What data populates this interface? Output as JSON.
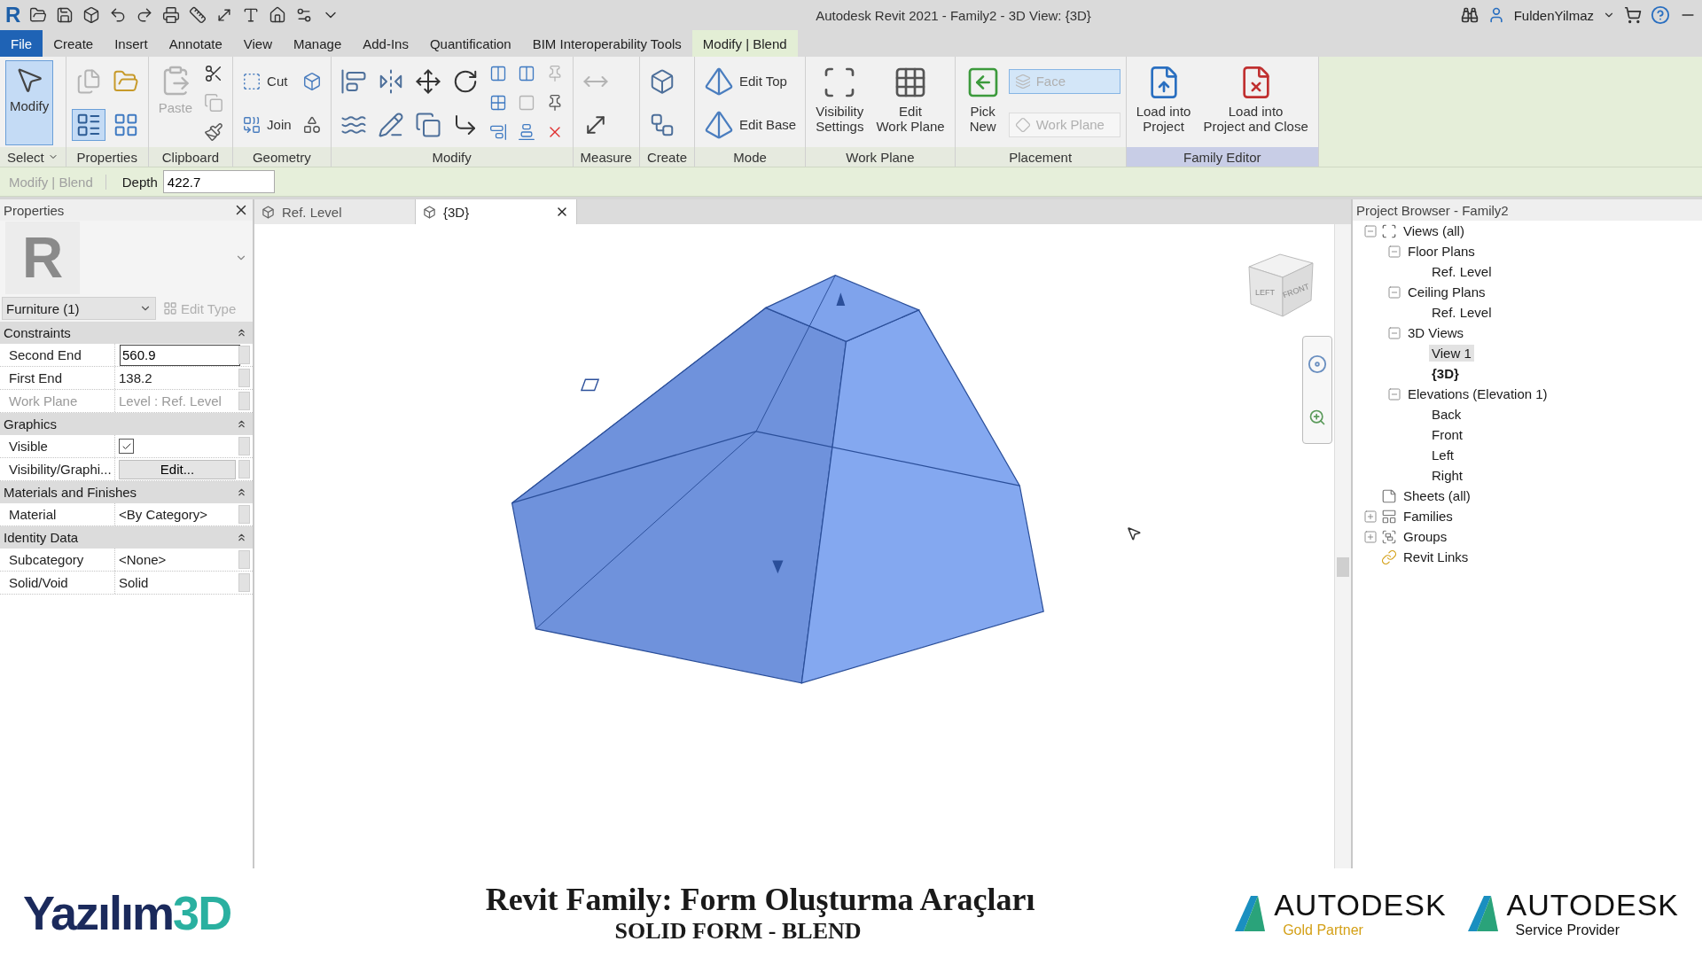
{
  "title_bar": {
    "app_logo": "R",
    "title": "Autodesk Revit 2021 - Family2 - 3D View: {3D}",
    "user": "FuldenYilmaz"
  },
  "menu_tabs": [
    {
      "label": "File",
      "kind": "file",
      "selected": false
    },
    {
      "label": "Create",
      "kind": "tab",
      "selected": false
    },
    {
      "label": "Insert",
      "kind": "tab",
      "selected": false
    },
    {
      "label": "Annotate",
      "kind": "tab",
      "selected": false
    },
    {
      "label": "View",
      "kind": "tab",
      "selected": false
    },
    {
      "label": "Manage",
      "kind": "tab",
      "selected": false
    },
    {
      "label": "Add-Ins",
      "kind": "tab",
      "selected": false
    },
    {
      "label": "Quantification",
      "kind": "tab",
      "selected": false
    },
    {
      "label": "BIM Interoperability Tools",
      "kind": "tab",
      "selected": false
    },
    {
      "label": "Modify | Blend",
      "kind": "context",
      "selected": true
    }
  ],
  "ribbon": {
    "panels": [
      {
        "label": "Select",
        "dropdown": true,
        "highlighted": false,
        "tools": [
          {
            "kind": "large",
            "label": "Modify",
            "selected": true,
            "disabled": false
          }
        ]
      },
      {
        "label": "Properties",
        "dropdown": false,
        "highlighted": false,
        "tools": [
          {
            "kind": "medium",
            "selected": false,
            "disabled": true
          },
          {
            "kind": "medium",
            "selected": true,
            "disabled": false
          },
          {
            "kind": "medium",
            "selected": false,
            "disabled": false
          },
          {
            "kind": "medium",
            "selected": false,
            "disabled": false
          }
        ]
      },
      {
        "label": "Clipboard",
        "dropdown": false,
        "highlighted": false,
        "tools": [
          {
            "kind": "large",
            "label": "Paste",
            "selected": false,
            "disabled": true
          },
          {
            "kind": "small",
            "selected": false,
            "disabled": false
          },
          {
            "kind": "small",
            "selected": false,
            "disabled": true
          },
          {
            "kind": "small",
            "selected": false,
            "disabled": false
          }
        ]
      },
      {
        "label": "Geometry",
        "dropdown": false,
        "highlighted": false,
        "tools": [
          {
            "kind": "medium",
            "label": "Cut",
            "selected": false,
            "disabled": false
          },
          {
            "kind": "medium",
            "label": "Join",
            "selected": false,
            "disabled": false
          },
          {
            "kind": "medium",
            "selected": false,
            "disabled": false
          },
          {
            "kind": "medium",
            "selected": false,
            "disabled": false
          }
        ]
      },
      {
        "label": "Modify",
        "dropdown": false,
        "highlighted": false,
        "tools": [
          {
            "kind": "medium",
            "selected": false,
            "disabled": false
          },
          {
            "kind": "medium",
            "selected": false,
            "disabled": false
          },
          {
            "kind": "medium",
            "selected": false,
            "disabled": false
          },
          {
            "kind": "medium",
            "selected": false,
            "disabled": false
          },
          {
            "kind": "medium",
            "selected": false,
            "disabled": false
          },
          {
            "kind": "medium",
            "selected": false,
            "disabled": false
          },
          {
            "kind": "medium",
            "selected": false,
            "disabled": false
          },
          {
            "kind": "medium",
            "selected": false,
            "disabled": false
          },
          {
            "kind": "small",
            "selected": false,
            "disabled": false
          },
          {
            "kind": "small",
            "selected": false,
            "disabled": false
          },
          {
            "kind": "small",
            "selected": false,
            "disabled": false
          },
          {
            "kind": "small",
            "selected": false,
            "disabled": false
          },
          {
            "kind": "small",
            "selected": false,
            "disabled": true
          },
          {
            "kind": "small",
            "selected": false,
            "disabled": false
          },
          {
            "kind": "small",
            "selected": false,
            "disabled": true
          },
          {
            "kind": "small",
            "selected": false,
            "disabled": false
          },
          {
            "kind": "small",
            "selected": false,
            "disabled": false
          }
        ]
      },
      {
        "label": "Measure",
        "dropdown": false,
        "highlighted": false,
        "tools": [
          {
            "kind": "medium",
            "selected": false,
            "disabled": true
          },
          {
            "kind": "medium",
            "selected": false,
            "disabled": false
          }
        ]
      },
      {
        "label": "Create",
        "dropdown": false,
        "highlighted": false,
        "tools": [
          {
            "kind": "medium",
            "selected": false,
            "disabled": false
          },
          {
            "kind": "medium",
            "selected": false,
            "disabled": false
          }
        ]
      },
      {
        "label": "Mode",
        "dropdown": false,
        "highlighted": false,
        "tools": [
          {
            "kind": "medium",
            "label": "Edit Top",
            "selected": false,
            "disabled": false
          },
          {
            "kind": "medium",
            "label": "Edit Base",
            "selected": false,
            "disabled": false
          }
        ]
      },
      {
        "label": "Work Plane",
        "dropdown": false,
        "highlighted": false,
        "tools": [
          {
            "kind": "large",
            "label": "Visibility\nSettings",
            "selected": false,
            "disabled": false
          },
          {
            "kind": "large",
            "label": "Edit\nWork Plane",
            "selected": false,
            "disabled": false
          }
        ]
      },
      {
        "label": "Placement",
        "dropdown": false,
        "highlighted": false,
        "tools": [
          {
            "kind": "large",
            "label": "Pick\nNew",
            "selected": false,
            "disabled": false
          },
          {
            "kind": "option",
            "label": "Face",
            "selected": true,
            "disabled": true
          },
          {
            "kind": "option",
            "label": "Work Plane",
            "selected": false,
            "disabled": true
          }
        ]
      },
      {
        "label": "Family Editor",
        "dropdown": false,
        "highlighted": true,
        "tools": [
          {
            "kind": "large",
            "label": "Load into\nProject",
            "selected": false,
            "disabled": false
          },
          {
            "kind": "large",
            "label": "Load into\nProject and Close",
            "selected": false,
            "disabled": false
          }
        ]
      }
    ]
  },
  "options_bar": {
    "context": "Modify | Blend",
    "depth_label": "Depth",
    "depth_value": "422.7"
  },
  "properties": {
    "title": "Properties",
    "preview_glyph": "R",
    "type_selector": "Furniture (1)",
    "edit_type": "Edit Type",
    "groups": [
      {
        "name": "Constraints",
        "rows": [
          {
            "name": "Second End",
            "kind": "input",
            "value": "560.9",
            "disabled": false
          },
          {
            "name": "First End",
            "kind": "text",
            "value": "138.2",
            "disabled": false
          },
          {
            "name": "Work Plane",
            "kind": "text",
            "value": "Level : Ref. Level",
            "disabled": true
          }
        ]
      },
      {
        "name": "Graphics",
        "rows": [
          {
            "name": "Visible",
            "kind": "checkbox",
            "checked": true,
            "disabled": false
          },
          {
            "name": "Visibility/Graphi...",
            "kind": "button",
            "value": "Edit...",
            "disabled": false
          }
        ]
      },
      {
        "name": "Materials and Finishes",
        "rows": [
          {
            "name": "Material",
            "kind": "text",
            "value": "<By Category>",
            "disabled": false
          }
        ]
      },
      {
        "name": "Identity Data",
        "rows": [
          {
            "name": "Subcategory",
            "kind": "text",
            "value": "<None>",
            "disabled": false
          },
          {
            "name": "Solid/Void",
            "kind": "text",
            "value": "Solid",
            "disabled": false
          }
        ]
      }
    ]
  },
  "view_tabs": [
    {
      "label": "Ref. Level",
      "selected": false
    },
    {
      "label": "{3D}",
      "selected": true
    }
  ],
  "viewport": {
    "view_cube": {
      "left": "LEFT",
      "front": "FRONT"
    }
  },
  "project_browser": {
    "title": "Project Browser - Family2",
    "tree": [
      {
        "label": "Views (all)",
        "expanded": true,
        "selected": false,
        "current": false,
        "children": [
          {
            "label": "Floor Plans",
            "expanded": true,
            "selected": false,
            "current": false,
            "children": [
              {
                "label": "Ref. Level",
                "selected": false,
                "current": false
              }
            ]
          },
          {
            "label": "Ceiling Plans",
            "expanded": true,
            "selected": false,
            "current": false,
            "children": [
              {
                "label": "Ref. Level",
                "selected": false,
                "current": false
              }
            ]
          },
          {
            "label": "3D Views",
            "expanded": true,
            "selected": false,
            "current": false,
            "children": [
              {
                "label": "View 1",
                "selected": true,
                "current": false
              },
              {
                "label": "{3D}",
                "selected": false,
                "current": true
              }
            ]
          },
          {
            "label": "Elevations (Elevation 1)",
            "expanded": true,
            "selected": false,
            "current": false,
            "children": [
              {
                "label": "Back",
                "selected": false,
                "current": false
              },
              {
                "label": "Front",
                "selected": false,
                "current": false
              },
              {
                "label": "Left",
                "selected": false,
                "current": false
              },
              {
                "label": "Right",
                "selected": false,
                "current": false
              }
            ]
          }
        ]
      },
      {
        "label": "Sheets (all)",
        "selected": false,
        "current": false
      },
      {
        "label": "Families",
        "expanded": false,
        "selected": false,
        "current": false
      },
      {
        "label": "Groups",
        "expanded": false,
        "selected": false,
        "current": false
      },
      {
        "label": "Revit Links",
        "selected": false,
        "current": false
      }
    ]
  },
  "banner": {
    "logo_main": "Yazılım",
    "logo_accent": "3D",
    "title": "Revit Family: Form Oluşturma Araçları",
    "subtitle": "SOLID FORM - BLEND",
    "partners": [
      {
        "brand": "AUTODESK",
        "tier": "Gold Partner",
        "color": "#d4a017"
      },
      {
        "brand": "AUTODESK",
        "tier": "Service Provider",
        "color": "#111111"
      }
    ]
  }
}
